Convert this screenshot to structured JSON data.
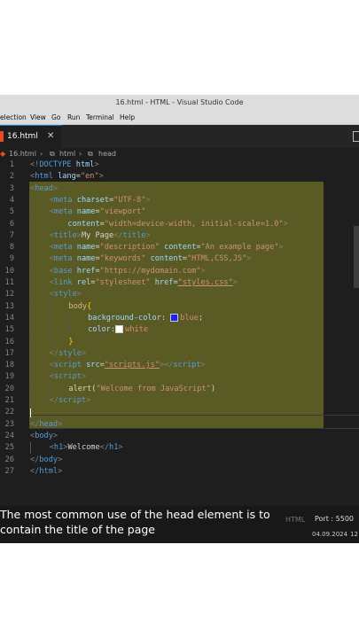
{
  "window": {
    "title": "16.html - HTML - Visual Studio Code"
  },
  "menu": [
    "election",
    "View",
    "Go",
    "Run",
    "Terminal",
    "Help"
  ],
  "tab": {
    "label": "16.html",
    "close": "✕"
  },
  "breadcrumb": {
    "file": "16.html",
    "sep": "›",
    "item1": "html",
    "item2": "head"
  },
  "code_lines": [
    {
      "n": "1",
      "parts": [
        [
          "br",
          "<!"
        ],
        [
          "tag",
          "DOCTYPE "
        ],
        [
          "attr",
          "html"
        ],
        [
          "br",
          ">"
        ]
      ]
    },
    {
      "n": "2",
      "parts": [
        [
          "br",
          "<"
        ],
        [
          "tag",
          "html "
        ],
        [
          "attr",
          "lang"
        ],
        [
          "txt",
          "="
        ],
        [
          "str",
          "\"en\""
        ],
        [
          "br",
          ">"
        ]
      ]
    },
    {
      "n": "3",
      "parts": [
        [
          "br",
          "<"
        ],
        [
          "tag",
          "head"
        ],
        [
          "br",
          ">"
        ]
      ]
    },
    {
      "n": "4",
      "parts": [
        [
          "ind",
          "    "
        ],
        [
          "br",
          "<"
        ],
        [
          "tag",
          "meta "
        ],
        [
          "attr",
          "charset"
        ],
        [
          "txt",
          "="
        ],
        [
          "str",
          "\"UTF-8\""
        ],
        [
          "br",
          ">"
        ]
      ]
    },
    {
      "n": "5",
      "parts": [
        [
          "ind",
          "    "
        ],
        [
          "br",
          "<"
        ],
        [
          "tag",
          "meta "
        ],
        [
          "attr",
          "name"
        ],
        [
          "txt",
          "="
        ],
        [
          "str",
          "\"viewport\""
        ]
      ]
    },
    {
      "n": "6",
      "parts": [
        [
          "ind",
          "    "
        ],
        [
          "txt",
          "    "
        ],
        [
          "attr",
          "content"
        ],
        [
          "txt",
          "="
        ],
        [
          "str",
          "\"width=device-width, initial-scale=1.0\""
        ],
        [
          "br",
          ">"
        ]
      ]
    },
    {
      "n": "7",
      "parts": [
        [
          "ind",
          "    "
        ],
        [
          "br",
          "<"
        ],
        [
          "tag",
          "title"
        ],
        [
          "br",
          ">"
        ],
        [
          "txt",
          "My Page"
        ],
        [
          "br",
          "</"
        ],
        [
          "tag",
          "title"
        ],
        [
          "br",
          ">"
        ]
      ]
    },
    {
      "n": "8",
      "parts": [
        [
          "ind",
          "    "
        ],
        [
          "br",
          "<"
        ],
        [
          "tag",
          "meta "
        ],
        [
          "attr",
          "name"
        ],
        [
          "txt",
          "="
        ],
        [
          "str",
          "\"description\" "
        ],
        [
          "attr",
          "content"
        ],
        [
          "txt",
          "="
        ],
        [
          "str",
          "\"An example page\""
        ],
        [
          "br",
          ">"
        ]
      ]
    },
    {
      "n": "9",
      "parts": [
        [
          "ind",
          "    "
        ],
        [
          "br",
          "<"
        ],
        [
          "tag",
          "meta "
        ],
        [
          "attr",
          "name"
        ],
        [
          "txt",
          "="
        ],
        [
          "str",
          "\"keywords\" "
        ],
        [
          "attr",
          "content"
        ],
        [
          "txt",
          "="
        ],
        [
          "str",
          "\"HTML,CSS,JS\""
        ],
        [
          "br",
          ">"
        ]
      ]
    },
    {
      "n": "10",
      "parts": [
        [
          "ind",
          "    "
        ],
        [
          "br",
          "<"
        ],
        [
          "tag",
          "base "
        ],
        [
          "attr",
          "href"
        ],
        [
          "txt",
          "="
        ],
        [
          "str",
          "\"https://mydomain.com\""
        ],
        [
          "br",
          ">"
        ]
      ]
    },
    {
      "n": "11",
      "parts": [
        [
          "ind",
          "    "
        ],
        [
          "br",
          "<"
        ],
        [
          "tag",
          "link "
        ],
        [
          "attr",
          "rel"
        ],
        [
          "txt",
          "="
        ],
        [
          "str",
          "\"stylesheet\" "
        ],
        [
          "attr",
          "href"
        ],
        [
          "txt",
          "="
        ],
        [
          "str",
          "\"styles.css\""
        ],
        [
          "br",
          ">"
        ]
      ]
    },
    {
      "n": "12",
      "parts": [
        [
          "ind",
          "    "
        ],
        [
          "br",
          "<"
        ],
        [
          "tag",
          "style"
        ],
        [
          "br",
          ">"
        ]
      ]
    },
    {
      "n": "13",
      "parts": [
        [
          "ind",
          "    "
        ],
        [
          "ind",
          "    "
        ],
        [
          "kw",
          "body"
        ],
        [
          "pun",
          "{"
        ]
      ]
    },
    {
      "n": "14",
      "parts": [
        [
          "ind",
          "    "
        ],
        [
          "ind",
          "    "
        ],
        [
          "ind",
          "    "
        ],
        [
          "attr",
          "background-color"
        ],
        [
          "txt",
          ": "
        ],
        [
          "swatch",
          "#1e1eff"
        ],
        [
          "str",
          "blue"
        ],
        [
          "txt",
          ";"
        ]
      ]
    },
    {
      "n": "15",
      "parts": [
        [
          "ind",
          "    "
        ],
        [
          "ind",
          "    "
        ],
        [
          "ind",
          "    "
        ],
        [
          "attr",
          "color"
        ],
        [
          "txt",
          ":"
        ],
        [
          "swatch",
          "#ffffff"
        ],
        [
          "str",
          "white"
        ]
      ]
    },
    {
      "n": "16",
      "parts": [
        [
          "ind",
          "    "
        ],
        [
          "ind",
          "    "
        ],
        [
          "pun",
          "}"
        ]
      ]
    },
    {
      "n": "17",
      "parts": [
        [
          "ind",
          "    "
        ],
        [
          "br",
          "</"
        ],
        [
          "tag",
          "style"
        ],
        [
          "br",
          ">"
        ]
      ]
    },
    {
      "n": "18",
      "parts": [
        [
          "ind",
          "    "
        ],
        [
          "br",
          "<"
        ],
        [
          "tag",
          "script "
        ],
        [
          "attr",
          "src"
        ],
        [
          "txt",
          "="
        ],
        [
          "str",
          "\"scripts.js\""
        ],
        [
          "br",
          "></"
        ],
        [
          "tag",
          "script"
        ],
        [
          "br",
          ">"
        ]
      ]
    },
    {
      "n": "19",
      "parts": [
        [
          "ind",
          "    "
        ],
        [
          "br",
          "<"
        ],
        [
          "tag",
          "script"
        ],
        [
          "br",
          ">"
        ]
      ]
    },
    {
      "n": "20",
      "parts": [
        [
          "ind",
          "    "
        ],
        [
          "ind",
          "    "
        ],
        [
          "fn",
          "alert"
        ],
        [
          "txt",
          "("
        ],
        [
          "str",
          "\"Welcome from JavaScript\""
        ],
        [
          "txt",
          ")"
        ]
      ]
    },
    {
      "n": "21",
      "parts": [
        [
          "ind",
          "    "
        ],
        [
          "br",
          "</"
        ],
        [
          "tag",
          "script"
        ],
        [
          "br",
          ">"
        ]
      ]
    },
    {
      "n": "22",
      "parts": []
    },
    {
      "n": "23",
      "parts": [
        [
          "br",
          "</"
        ],
        [
          "tag",
          "head"
        ],
        [
          "br",
          ">"
        ]
      ]
    },
    {
      "n": "24",
      "parts": [
        [
          "br",
          "<"
        ],
        [
          "tag",
          "body"
        ],
        [
          "br",
          ">"
        ]
      ]
    },
    {
      "n": "25",
      "parts": [
        [
          "ind",
          "    "
        ],
        [
          "br",
          "<"
        ],
        [
          "tag",
          "h1"
        ],
        [
          "br",
          ">"
        ],
        [
          "txt",
          "Welcome"
        ],
        [
          "br",
          "</"
        ],
        [
          "tag",
          "h1"
        ],
        [
          "br",
          ">"
        ]
      ]
    },
    {
      "n": "26",
      "parts": [
        [
          "br",
          "</"
        ],
        [
          "tag",
          "body"
        ],
        [
          "br",
          ">"
        ]
      ]
    },
    {
      "n": "27",
      "parts": [
        [
          "br",
          "</"
        ],
        [
          "tag",
          "html"
        ],
        [
          "br",
          ">"
        ]
      ]
    }
  ],
  "caption": {
    "line1": "The most common use of the head element is to",
    "line2": "contain the title of the page"
  },
  "status": {
    "language": "HTML",
    "port": "Port : 5500",
    "date": "04.09.2024",
    "time": "12"
  },
  "colors": {
    "highlight": "#5a5a24",
    "tag": "#569cd6",
    "attr": "#9cdcfe",
    "string": "#ce9178"
  }
}
